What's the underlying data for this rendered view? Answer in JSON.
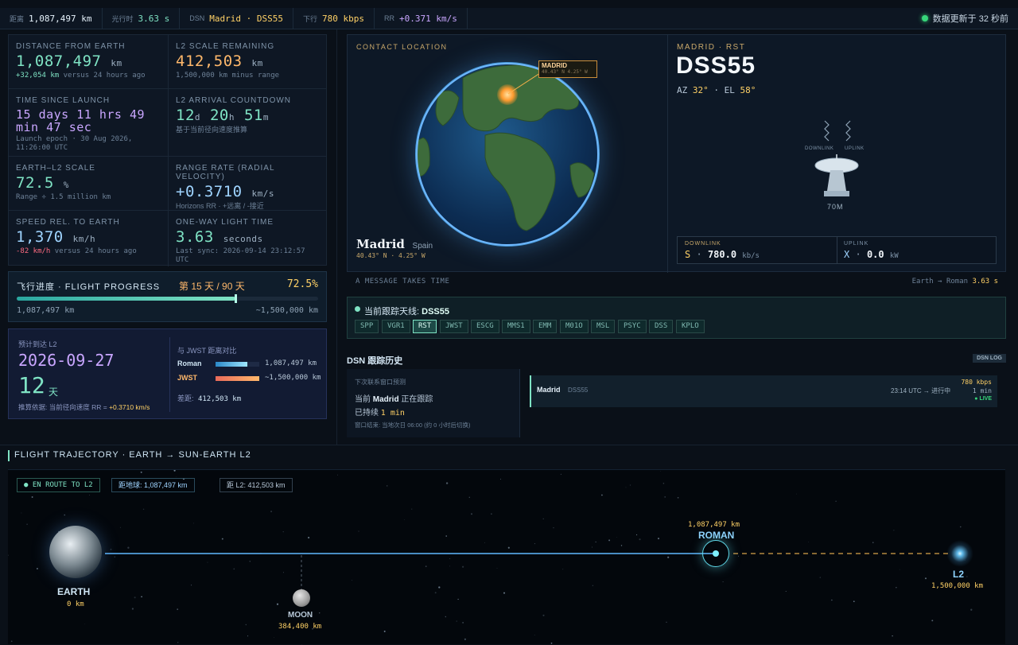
{
  "topbar": {
    "distance_label": "距离",
    "distance_value": "1,087,497 km",
    "light_label": "光行时",
    "light_value": "3.63 s",
    "dsn_label": "DSN",
    "dsn_value": "Madrid · DSS55",
    "down_label": "下行",
    "down_value": "780 kbps",
    "rr_label": "RR",
    "rr_value": "+0.371 km/s",
    "updated_text": "数据更新于 32 秒前"
  },
  "metrics": {
    "distance": {
      "label": "DISTANCE FROM EARTH",
      "value": "1,087,497",
      "unit": "km",
      "delta": "+32,054 km",
      "sub": "versus 24 hours ago"
    },
    "l2_scale": {
      "label": "L2 SCALE REMAINING",
      "value": "412,503",
      "unit": "km",
      "sub": "1,500,000 km minus range"
    },
    "since_launch": {
      "label": "TIME SINCE LAUNCH",
      "value": "15 days 11 hrs 49 min 47 sec",
      "sub": "Launch epoch · 30 Aug 2026, 11:26:00 UTC"
    },
    "arrival": {
      "label": "L2 ARRIVAL COUNTDOWN",
      "d": "12",
      "d_unit": "d",
      "h": "20",
      "h_unit": "h",
      "m": "51",
      "m_unit": "m",
      "sub": "基于当前径向速度推算"
    },
    "scale": {
      "label": "EARTH–L2 SCALE",
      "value": "72.5",
      "unit": "%",
      "sub": "Range ÷ 1.5 million km"
    },
    "range_rate": {
      "label": "RANGE RATE (RADIAL VELOCITY)",
      "value": "+0.3710",
      "unit": "km/s",
      "sub": "Horizons RR · +远离 / -接近"
    },
    "speed": {
      "label": "SPEED REL. TO EARTH",
      "value": "1,370",
      "unit": "km/h",
      "delta": "-82 km/h",
      "sub": "versus 24 hours ago"
    },
    "light_time": {
      "label": "ONE-WAY LIGHT TIME",
      "value": "3.63",
      "unit": "seconds",
      "sub": "Last sync: 2026-09-14 23:12:57 UTC"
    }
  },
  "progress": {
    "title": "飞行进度 · FLIGHT PROGRESS",
    "days": "第 15 天 / 90 天",
    "percent_text": "72.5%",
    "fraction": 0.725,
    "left": "1,087,497 km",
    "right": "~1,500,000 km"
  },
  "eta": {
    "label": "预计到达 L2",
    "date": "2026-09-27",
    "days": "12",
    "days_unit": "天",
    "basis": "推算依据: 当前径向速度 RR =",
    "basis_value": "+0.3710 km/s",
    "compare_title": "与 JWST 距离对比",
    "rows": [
      {
        "name": "Roman",
        "value": "1,087,497 km",
        "fraction": 0.725
      },
      {
        "name": "JWST",
        "value": "~1,500,000 km",
        "fraction": 1.0
      }
    ],
    "diff_label": "差距:",
    "diff_value": "412,503 km"
  },
  "contact": {
    "section_label": "CONTACT LOCATION",
    "marker_label": "MADRID",
    "marker_coords": "40.43° N  4.25° W",
    "city": "Madrid",
    "country": "Spain",
    "coords": "40.43° N  ·  4.25° W",
    "station_sub": "MADRID · RST",
    "station": "DSS55",
    "az_label": "AZ",
    "az_value": "32°",
    "el_label": "EL",
    "el_value": "58°",
    "downlink_tag": "DOWNLINK",
    "uplink_tag": "UPLINK",
    "dish_size": "70M",
    "downlink_label": "DOWNLINK",
    "downlink_band": "S",
    "downlink_value": "780.0",
    "downlink_unit": "kb/s",
    "uplink_label": "UPLINK",
    "uplink_band": "X",
    "uplink_value": "0.0",
    "uplink_unit": "kW"
  },
  "message": {
    "left": "A MESSAGE TAKES TIME",
    "right_prefix": "Earth → Roman",
    "right_value": "3.63 s"
  },
  "tracking": {
    "title_prefix": "当前跟踪天线:",
    "title_value": "DSS55",
    "chips": [
      "SPP",
      "VGR1",
      "RST",
      "JWST",
      "ESCG",
      "MMS1",
      "EMM",
      "M01O",
      "MSL",
      "PSYC",
      "DSS",
      "KPLO"
    ],
    "selected": "RST"
  },
  "history": {
    "title": "DSN 跟踪历史",
    "badge": "DSN LOG",
    "forecast_label": "下次联系窗口预测",
    "now_prefix": "当前",
    "now_city": "Madrid",
    "now_suffix": "正在跟踪",
    "lasted_prefix": "已持续",
    "lasted_value": "1 min",
    "window_end": "窗口结束: 当地次日 06:00 (约 0 小时后切换)",
    "pass_city": "Madrid",
    "pass_station": "DSS55",
    "pass_time": "23:14 UTC → 进行中",
    "pass_rate": "780 kbps",
    "pass_duration": "1 min",
    "pass_live": "LIVE"
  },
  "trajectory": {
    "title": "FLIGHT TRAJECTORY · EARTH → SUN-EARTH L2",
    "tag_route": "EN ROUTE TO L2",
    "tag_dist": "距地球: 1,087,497 km",
    "tag_l2": "距 L2: 412,503 km",
    "earth_label": "EARTH",
    "earth_km": "0 km",
    "moon_label": "MOON",
    "moon_km": "384,400 km",
    "roman_label": "ROMAN",
    "roman_km": "1,087,497 km",
    "l2_label": "L2",
    "l2_km": "1,500,000 km"
  }
}
